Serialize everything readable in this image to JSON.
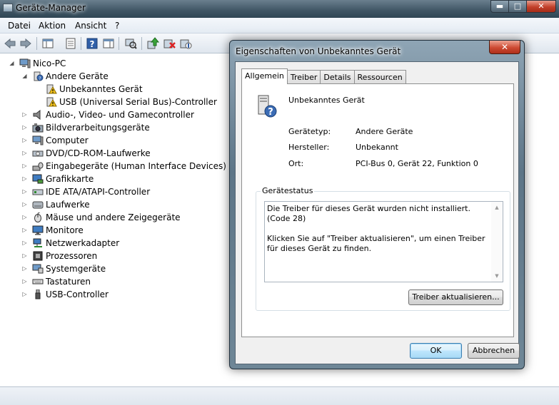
{
  "window": {
    "title": "Geräte-Manager",
    "minimize": "▬",
    "maximize": "□",
    "close": "✕"
  },
  "menu": [
    "Datei",
    "Aktion",
    "Ansicht",
    "?"
  ],
  "toolbar_icons": [
    "back-arrow-icon",
    "forward-arrow-icon",
    "console-tree-icon",
    "properties-icon",
    "help-icon",
    "action-pane-icon",
    "scan-hardware-icon",
    "update-driver-icon",
    "uninstall-icon",
    "disable-icon"
  ],
  "tree": {
    "root": "Nico-PC",
    "groups": [
      {
        "label": "Andere Geräte",
        "expanded": true,
        "icon": "unknown-device-icon",
        "children": [
          "Unbekanntes Gerät",
          "USB (Universal Serial Bus)-Controller"
        ]
      },
      {
        "label": "Audio-, Video- und Gamecontroller",
        "icon": "speaker-icon"
      },
      {
        "label": "Bildverarbeitungsgeräte",
        "icon": "camera-icon"
      },
      {
        "label": "Computer",
        "icon": "computer-icon"
      },
      {
        "label": "DVD/CD-ROM-Laufwerke",
        "icon": "dvd-drive-icon"
      },
      {
        "label": "Eingabegeräte (Human Interface Devices)",
        "icon": "hid-icon"
      },
      {
        "label": "Grafikkarte",
        "icon": "display-adapter-icon"
      },
      {
        "label": "IDE ATA/ATAPI-Controller",
        "icon": "ide-controller-icon"
      },
      {
        "label": "Laufwerke",
        "icon": "disk-drive-icon"
      },
      {
        "label": "Mäuse und andere Zeigegeräte",
        "icon": "mouse-icon"
      },
      {
        "label": "Monitore",
        "icon": "monitor-icon"
      },
      {
        "label": "Netzwerkadapter",
        "icon": "network-adapter-icon"
      },
      {
        "label": "Prozessoren",
        "icon": "processor-icon"
      },
      {
        "label": "Systemgeräte",
        "icon": "system-device-icon"
      },
      {
        "label": "Tastaturen",
        "icon": "keyboard-icon"
      },
      {
        "label": "USB-Controller",
        "icon": "usb-icon"
      }
    ]
  },
  "dialog": {
    "title": "Eigenschaften von Unbekanntes Gerät",
    "close": "✕",
    "tabs": [
      "Allgemein",
      "Treiber",
      "Details",
      "Ressourcen"
    ],
    "active_tab": "Allgemein",
    "device_name": "Unbekanntes Gerät",
    "properties": [
      {
        "label": "Gerätetyp:",
        "value": "Andere Geräte"
      },
      {
        "label": "Hersteller:",
        "value": "Unbekannt"
      },
      {
        "label": "Ort:",
        "value": "PCI-Bus 0, Gerät 22, Funktion 0"
      }
    ],
    "status_group": "Gerätestatus",
    "status_text_1": "Die Treiber für dieses Gerät wurden nicht installiert. (Code 28)",
    "status_text_2": "Klicken Sie auf \"Treiber aktualisieren\", um einen Treiber für dieses Gerät zu finden.",
    "update_button": "Treiber aktualisieren...",
    "ok_button": "OK",
    "cancel_button": "Abbrechen"
  }
}
